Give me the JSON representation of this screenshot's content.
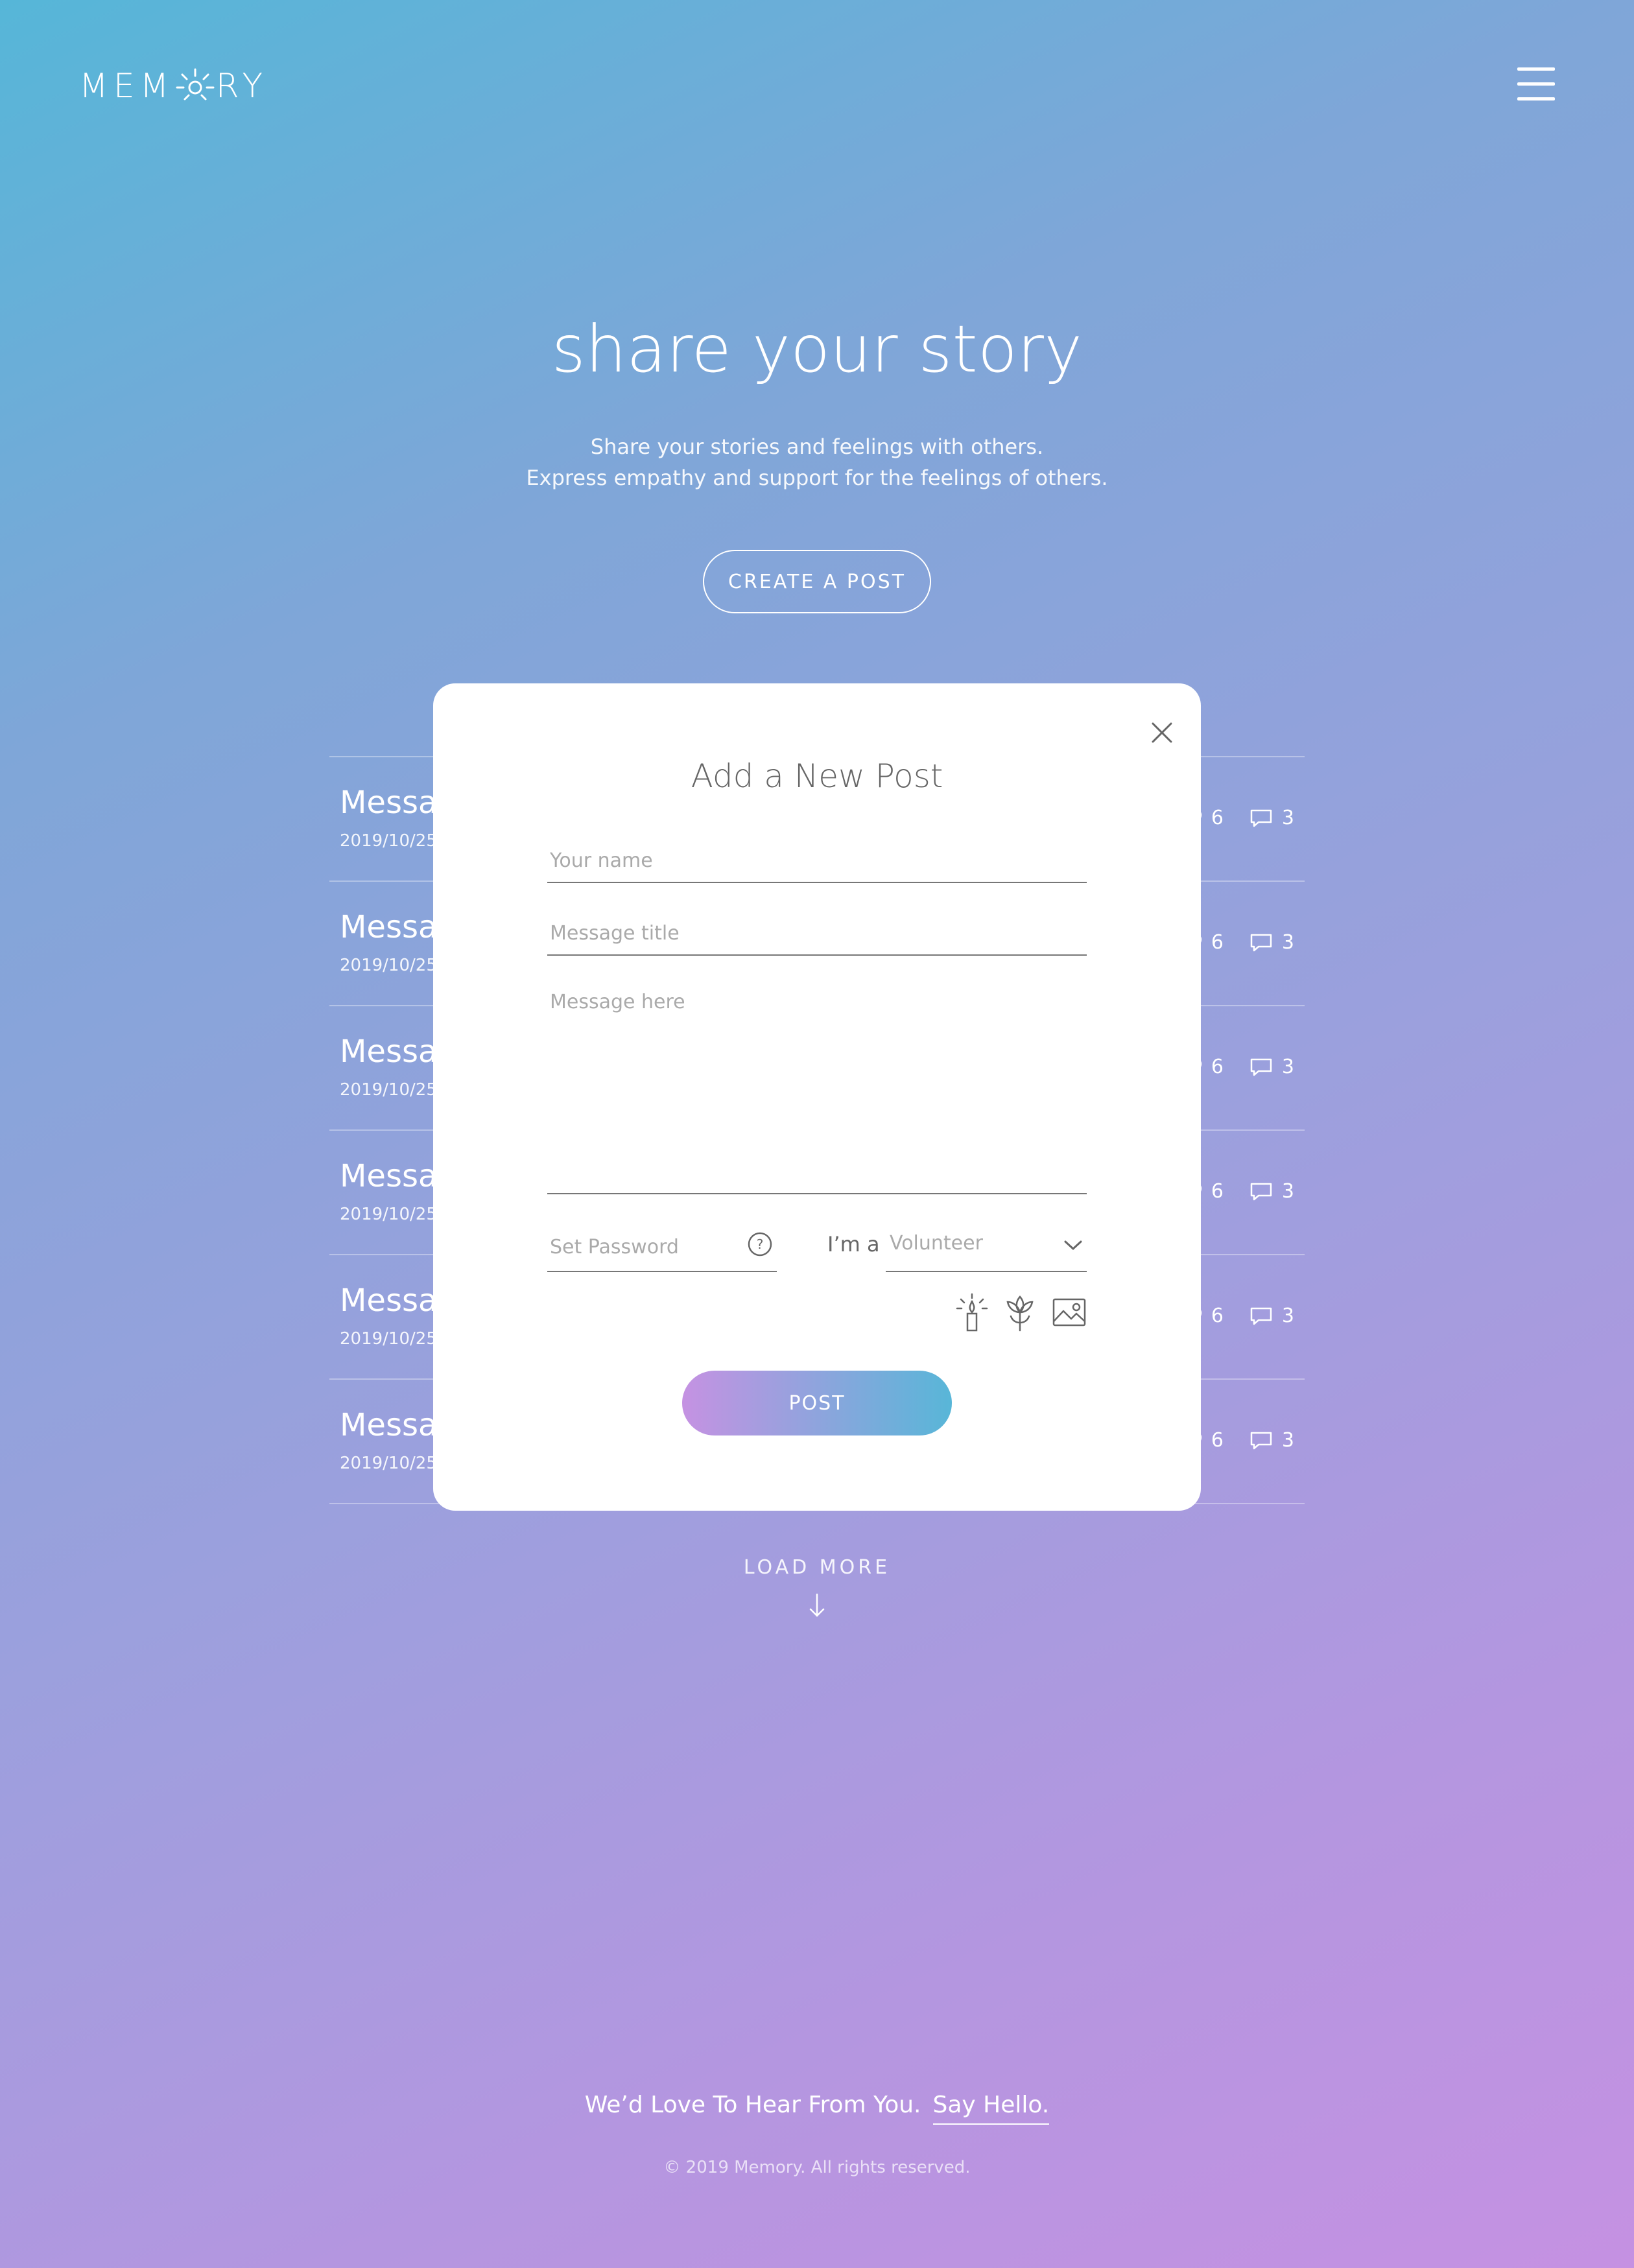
{
  "header": {
    "logo_left": "MEM",
    "logo_right": "RY",
    "menu_icon": "hamburger-menu-icon"
  },
  "hero": {
    "title": "share your story",
    "subtitle_line1": "Share your stories and feelings with others.",
    "subtitle_line2": "Express empathy and support for the feelings of others.",
    "cta_label": "CREATE A POST"
  },
  "posts": [
    {
      "title": "Messag",
      "date": "2019/10/25",
      "likes": "6",
      "comments": "3"
    },
    {
      "title": "Messag",
      "date": "2019/10/25",
      "likes": "6",
      "comments": "3"
    },
    {
      "title": "Messag",
      "date": "2019/10/25",
      "likes": "6",
      "comments": "3"
    },
    {
      "title": "Messag",
      "date": "2019/10/25",
      "likes": "6",
      "comments": "3"
    },
    {
      "title": "Messag",
      "date": "2019/10/25",
      "likes": "6",
      "comments": "3"
    },
    {
      "title": "Messag",
      "date": "2019/10/25",
      "likes": "6",
      "comments": "3"
    }
  ],
  "modal": {
    "title": "Add a New Post",
    "name_placeholder": "Your name",
    "title_placeholder": "Message title",
    "message_placeholder": "Message here",
    "password_placeholder": "Set Password",
    "role_label": "I’m a",
    "role_value": "Volunteer",
    "tool_icons": [
      "candle-icon",
      "flower-icon",
      "image-icon"
    ],
    "submit_label": "POST"
  },
  "load_more": "LOAD MORE",
  "footer": {
    "tagline": "We’d Love To Hear From You.",
    "link": "Say Hello.",
    "copyright": "© 2019 Memory. All rights reserved."
  },
  "colors": {
    "gradient_start": "#56b6d8",
    "gradient_end": "#c591e2",
    "modal_bg": "#ffffff"
  }
}
